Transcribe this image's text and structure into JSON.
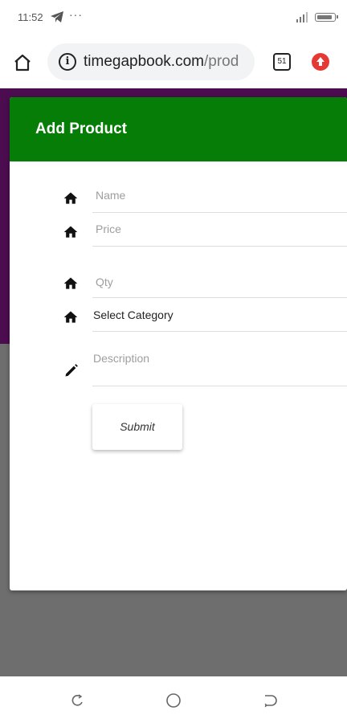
{
  "status_bar": {
    "time": "11:52",
    "dots": "···",
    "icons": [
      "telegram-icon",
      "signal-icon",
      "battery-icon"
    ]
  },
  "browser": {
    "url_host": "timegapbook.com",
    "url_path": "/prod",
    "tab_count": "51",
    "icons": [
      "home-icon",
      "info-icon",
      "extension-icon"
    ]
  },
  "dialog": {
    "title": "Add Product",
    "header_color": "#067d06",
    "fields": {
      "name": {
        "placeholder": "Name",
        "icon": "home-icon"
      },
      "price": {
        "placeholder": "Price",
        "icon": "home-icon"
      },
      "qty": {
        "placeholder": "Qty",
        "icon": "home-icon"
      },
      "category": {
        "value": "Select Category",
        "icon": "home-icon"
      },
      "description": {
        "placeholder": "Description",
        "icon": "pencil-icon"
      }
    },
    "submit_label": "Submit"
  },
  "colors": {
    "purple_band": "#4b0d4f",
    "backdrop": "#6e6e6e"
  },
  "nav_bar": {
    "icons": [
      "recent-apps-icon",
      "home-circle-icon",
      "back-icon"
    ]
  }
}
